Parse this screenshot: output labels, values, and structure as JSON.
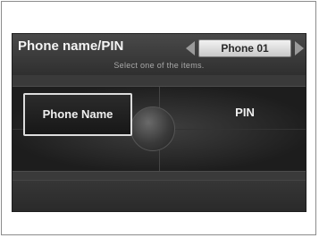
{
  "header": {
    "title": "Phone name/PIN",
    "subtitle": "Select one of the items."
  },
  "phone_selector": {
    "current": "Phone 01"
  },
  "menu": {
    "items": [
      {
        "label": "Phone Name",
        "selected": true
      },
      {
        "label": "PIN",
        "selected": false
      }
    ]
  }
}
